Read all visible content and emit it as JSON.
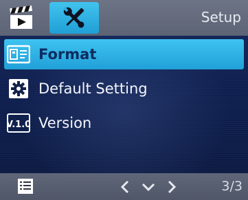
{
  "header": {
    "tabs": [
      {
        "name": "video-mode",
        "icon": "clapperboard-icon",
        "active": false
      },
      {
        "name": "setup",
        "icon": "tools-icon",
        "active": true
      }
    ],
    "title": "Setup"
  },
  "menu": {
    "items": [
      {
        "label": "Format",
        "icon": "format-card-icon",
        "selected": true
      },
      {
        "label": "Default Setting",
        "icon": "gear-icon",
        "selected": false
      },
      {
        "label": "Version",
        "icon": "version-badge-icon",
        "selected": false
      }
    ]
  },
  "footer": {
    "left_icon": "menu-list-icon",
    "nav": [
      "chevron-left-icon",
      "chevron-down-icon",
      "chevron-right-icon"
    ],
    "page": "3/3"
  },
  "colors": {
    "accent": "#2bb0e4",
    "topbar": "#646b7c",
    "background": "#12234f",
    "text": "#f4f6fa"
  }
}
